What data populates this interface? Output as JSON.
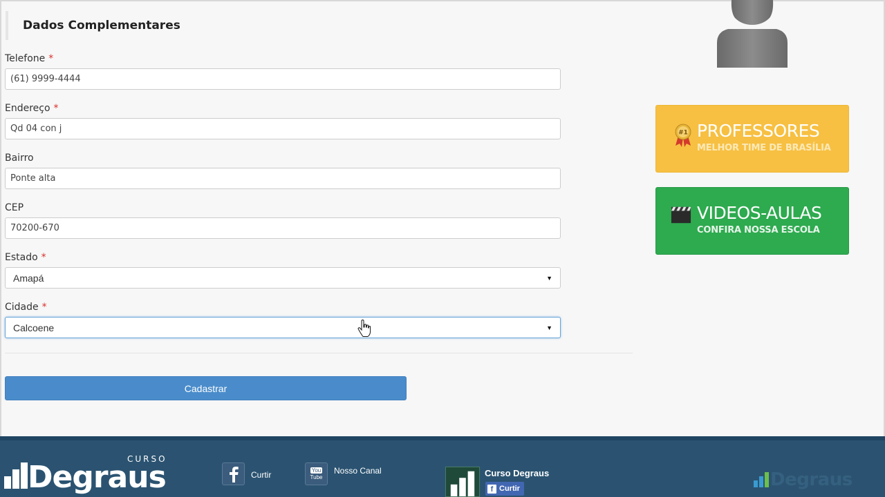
{
  "section": {
    "title": "Dados Complementares"
  },
  "form": {
    "required_marker": "*",
    "telefone": {
      "label": "Telefone",
      "value": "(61) 9999-4444"
    },
    "endereco": {
      "label": "Endereço",
      "value": "Qd 04 con j"
    },
    "bairro": {
      "label": "Bairro",
      "value": "Ponte alta"
    },
    "cep": {
      "label": "CEP",
      "value": "70200-670"
    },
    "estado": {
      "label": "Estado",
      "value": "Amapá"
    },
    "cidade": {
      "label": "Cidade",
      "value": "Calcoene"
    },
    "submit_label": "Cadastrar"
  },
  "promos": [
    {
      "title": "PROFESSORES",
      "subtitle": "MELHOR TIME DE BRASÍLIA",
      "icon": "award-ribbon-icon",
      "color": "#f7c042"
    },
    {
      "title": "VIDEOS-AULAS",
      "subtitle": "CONFIRA NOSSA ESCOLA",
      "icon": "clapperboard-icon",
      "color": "#2eaa4f"
    }
  ],
  "footer": {
    "logo": {
      "curso": "CURSO",
      "brand": "Degraus"
    },
    "facebook": {
      "label": "Curtir"
    },
    "youtube": {
      "label": "Nosso Canal",
      "badge_top": "You",
      "badge_bottom": "Tube"
    },
    "fb_page": {
      "name": "Curso Degraus",
      "like": "Curtir"
    },
    "right_logo": {
      "brand": "Degraus"
    },
    "color": "#2b5371"
  },
  "accent": "#4a8ccb"
}
